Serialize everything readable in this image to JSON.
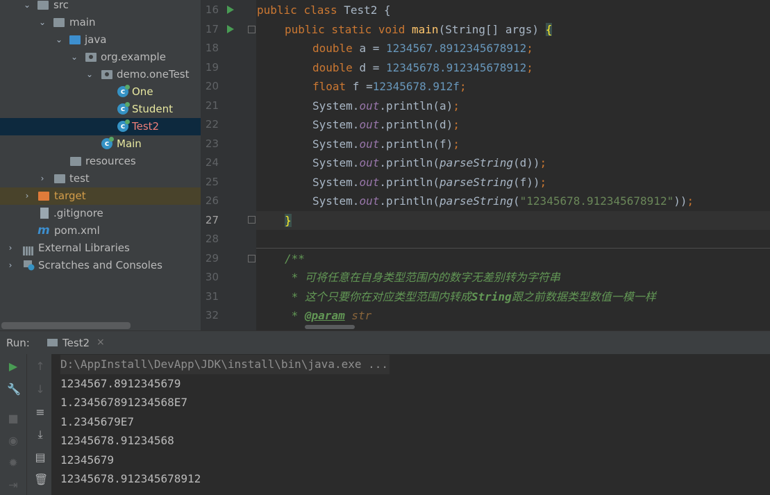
{
  "project_tree": {
    "items": [
      {
        "label": "src",
        "type": "folder"
      },
      {
        "label": "main",
        "type": "folder"
      },
      {
        "label": "java",
        "type": "folder-source"
      },
      {
        "label": "org.example",
        "type": "package"
      },
      {
        "label": "demo.oneTest",
        "type": "package"
      },
      {
        "label": "One",
        "type": "class"
      },
      {
        "label": "Student",
        "type": "class"
      },
      {
        "label": "Test2",
        "type": "class",
        "selected": true
      },
      {
        "label": "Main",
        "type": "class"
      },
      {
        "label": "resources",
        "type": "folder-resources"
      },
      {
        "label": "test",
        "type": "folder"
      },
      {
        "label": "target",
        "type": "folder-excluded"
      },
      {
        "label": ".gitignore",
        "type": "file"
      },
      {
        "label": "pom.xml",
        "type": "maven-file"
      },
      {
        "label": "External Libraries",
        "type": "libraries"
      },
      {
        "label": "Scratches and Consoles",
        "type": "scratches"
      }
    ],
    "colors": {
      "class_label": "#e8e8a0",
      "selected_label": "#ef7f79",
      "target_label": "#d49e4a"
    }
  },
  "editor": {
    "line_numbers": [
      "16",
      "17",
      "18",
      "19",
      "20",
      "21",
      "22",
      "23",
      "24",
      "25",
      "26",
      "27",
      "28",
      "29",
      "30",
      "31",
      "32"
    ],
    "current_line": "27",
    "code": {
      "l16": {
        "kw1": "public ",
        "kw2": "class ",
        "name": "Test2 {"
      },
      "l17": {
        "kw": "public static void ",
        "fn": "main",
        "rest": "(String[] args) ",
        "brace": "{"
      },
      "l18": {
        "kw": "double ",
        "rest": "a = ",
        "num": "1234567.8912345678912",
        "semi": ";"
      },
      "l19": {
        "kw": "double ",
        "rest": "d = ",
        "num": "12345678.912345678912",
        "semi": ";"
      },
      "l20": {
        "kw": "float ",
        "rest": "f =",
        "num": "12345678.912f",
        "semi": ";"
      },
      "l21": {
        "cls": "System.",
        "fld": "out",
        "rest": ".println(a)",
        "semi": ";"
      },
      "l22": {
        "cls": "System.",
        "fld": "out",
        "rest": ".println(d)",
        "semi": ";"
      },
      "l23": {
        "cls": "System.",
        "fld": "out",
        "rest": ".println(f)",
        "semi": ";"
      },
      "l24": {
        "cls": "System.",
        "fld": "out",
        "p1": ".println(",
        "call": "parseString",
        "p2": "(d))",
        "semi": ";"
      },
      "l25": {
        "cls": "System.",
        "fld": "out",
        "p1": ".println(",
        "call": "parseString",
        "p2": "(f))",
        "semi": ";"
      },
      "l26": {
        "cls": "System.",
        "fld": "out",
        "p1": ".println(",
        "call": "parseString",
        "p3": "(",
        "str": "\"12345678.912345678912\"",
        "p4": "))",
        "semi": ";"
      },
      "l27": {
        "brace": "}"
      },
      "l29": {
        "doc": "/**"
      },
      "l30": {
        "doc": " * 可将任意在自身类型范围内的数字无差别转为字符串"
      },
      "l31": {
        "d1": " * 这个只要你在对应类型范围内转成",
        "bold": "String",
        "d2": "跟之前数据类型数值一模一样"
      },
      "l32": {
        "d1": " * ",
        "tag": "@param",
        "sp": " ",
        "param": "str"
      }
    },
    "colors": {
      "keyword": "#cc7832",
      "number": "#6897bb",
      "method": "#ffc66d",
      "field": "#9876aa",
      "string": "#6a8759",
      "doc": "#629755"
    }
  },
  "run_panel": {
    "label": "Run:",
    "tab": {
      "label": "Test2",
      "close": "×"
    },
    "tools_left": [
      "play-icon",
      "wrench-icon",
      "stop-icon",
      "camera-icon",
      "bug-icon",
      "login-icon"
    ],
    "tools_right": [
      "arrow-up-icon",
      "arrow-down-icon",
      "soft-wrap-icon",
      "scroll-to-end-icon",
      "print-icon",
      "trash-icon"
    ],
    "console": {
      "command": "D:\\AppInstall\\DevApp\\JDK\\install\\bin\\java.exe ...",
      "lines": [
        "1234567.8912345679",
        "1.234567891234568E7",
        "1.2345679E7",
        "12345678.91234568",
        "12345679",
        "12345678.912345678912"
      ]
    }
  }
}
